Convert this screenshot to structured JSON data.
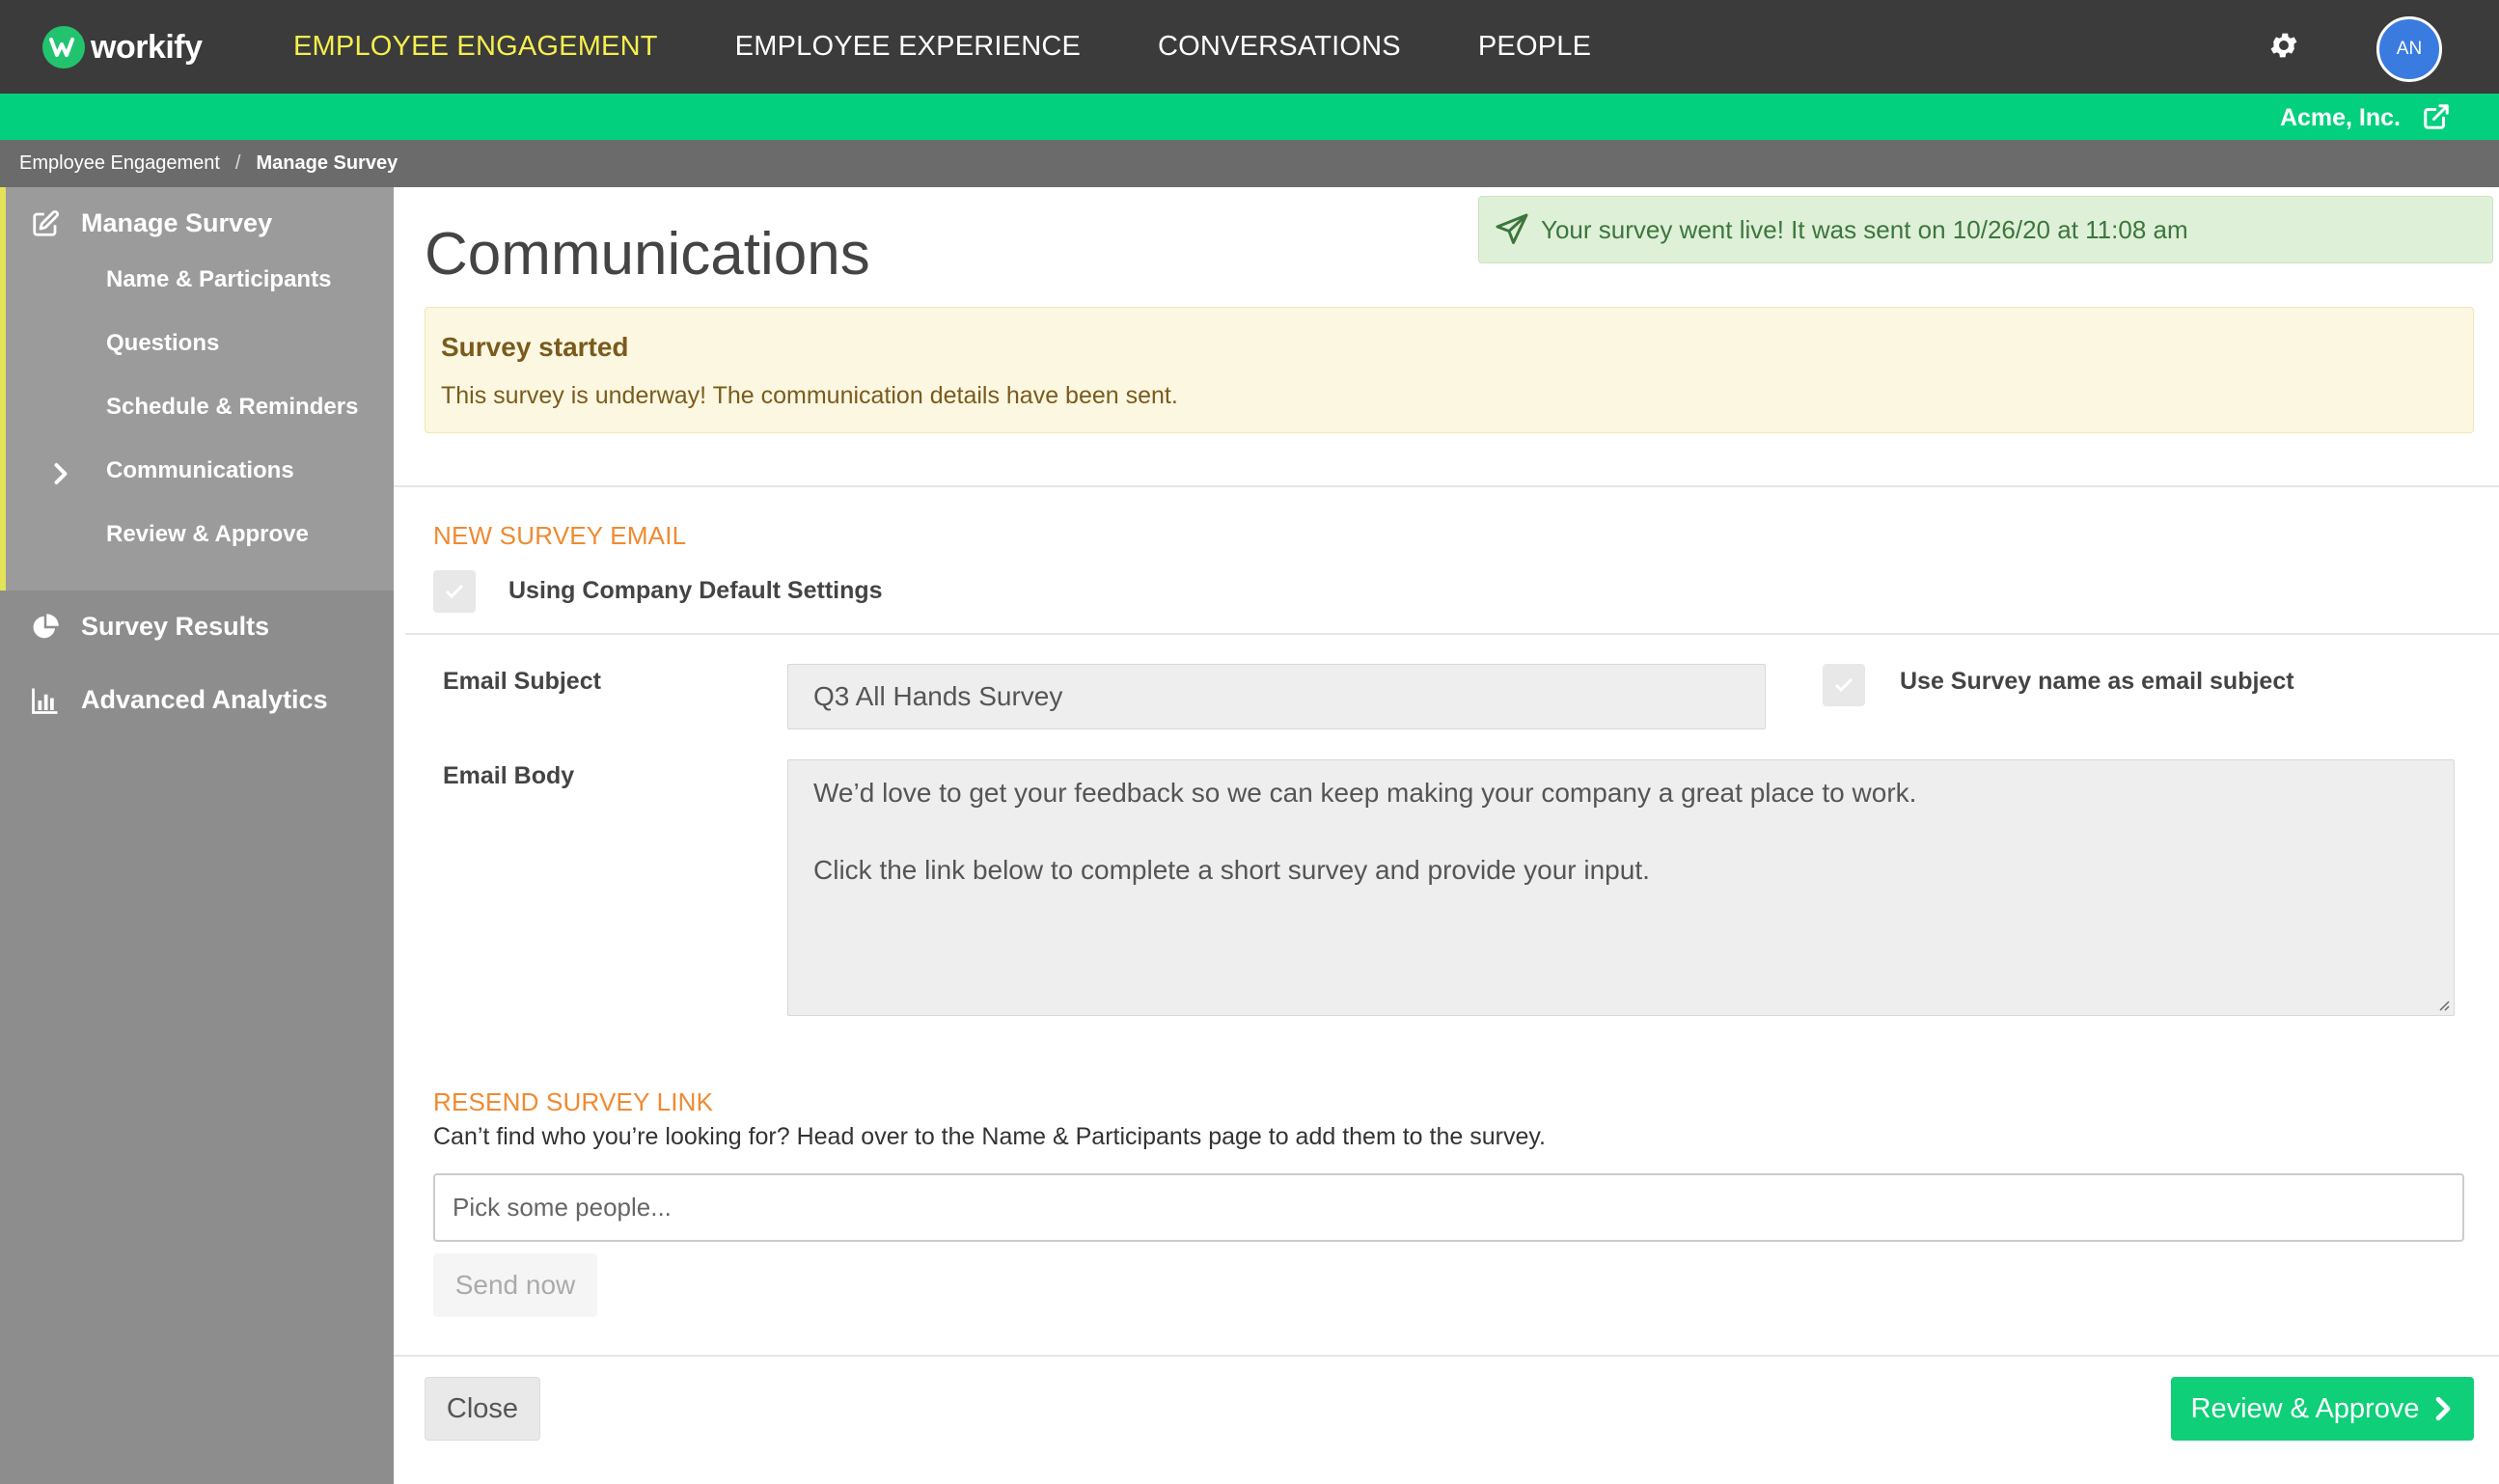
{
  "app": {
    "name": "workify"
  },
  "nav": {
    "items": [
      {
        "label": "EMPLOYEE ENGAGEMENT",
        "active": true
      },
      {
        "label": "EMPLOYEE EXPERIENCE"
      },
      {
        "label": "CONVERSATIONS"
      },
      {
        "label": "PEOPLE"
      }
    ]
  },
  "user": {
    "initials": "AN"
  },
  "company": {
    "name": "Acme, Inc."
  },
  "breadcrumb": {
    "root": "Employee Engagement",
    "separator": "/",
    "current": "Manage Survey"
  },
  "sidebar": {
    "manage": "Manage Survey",
    "items": [
      "Name & Participants",
      "Questions",
      "Schedule & Reminders",
      "Communications",
      "Review & Approve"
    ],
    "results": "Survey Results",
    "analytics": "Advanced Analytics"
  },
  "page": {
    "title": "Communications"
  },
  "alert": {
    "text": "Your survey went live! It was sent on 10/26/20 at 11:08 am"
  },
  "warning": {
    "title": "Survey started",
    "text": "This survey is underway! The communication details have been sent."
  },
  "email": {
    "section": "NEW SURVEY EMAIL",
    "default_settings": "Using Company Default Settings",
    "subject_label": "Email Subject",
    "subject_value": "Q3 All Hands Survey",
    "use_name_label": "Use Survey name as email subject",
    "body_label": "Email Body",
    "body_line1": "We’d love to get your feedback so we can keep making your company a great place to work.",
    "body_line2": "Click the link below to complete a short survey and provide your input."
  },
  "resend": {
    "section": "RESEND SURVEY LINK",
    "description": "Can’t find who you’re looking for? Head over to the Name & Participants page to add them to the survey.",
    "placeholder": "Pick some people...",
    "send_label": "Send now"
  },
  "footer": {
    "close": "Close",
    "review": "Review & Approve"
  },
  "colors": {
    "brand_green": "#03d07e",
    "nav_active": "#f5ee4e",
    "section_orange": "#f08a31",
    "topbar": "#3b3b3b"
  }
}
